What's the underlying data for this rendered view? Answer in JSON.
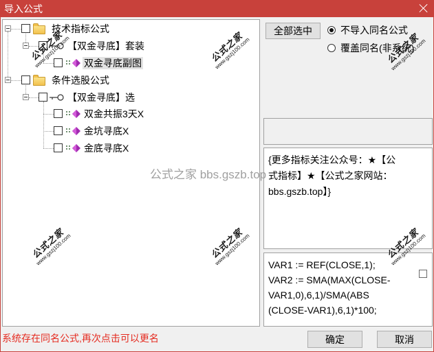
{
  "window": {
    "title": "导入公式"
  },
  "tree": [
    {
      "label": "技术指标公式",
      "icon": "folder-icon",
      "expanded": true,
      "checked": false,
      "children": [
        {
          "label": "【双金寻底】套装",
          "icon": "key-icon",
          "expanded": true,
          "checked": false,
          "children": [
            {
              "label": "双金寻底副图",
              "icon": "diamond-icon",
              "checked": false,
              "selected": true
            }
          ]
        }
      ]
    },
    {
      "label": "条件选股公式",
      "icon": "folder-icon",
      "expanded": true,
      "checked": false,
      "children": [
        {
          "label": "【双金寻底】选",
          "icon": "key-icon",
          "expanded": true,
          "checked": false,
          "children": [
            {
              "label": "双金共振3天X",
              "icon": "diamond-icon",
              "checked": false,
              "selected": false
            },
            {
              "label": "金坑寻底X",
              "icon": "diamond-icon",
              "checked": false,
              "selected": false
            },
            {
              "label": "金底寻底X",
              "icon": "diamond-icon",
              "checked": false,
              "selected": false
            }
          ]
        }
      ]
    }
  ],
  "toolbar": {
    "select_all_label": "全部选中"
  },
  "import_options": [
    {
      "label": "不导入同名公式",
      "checked": true
    },
    {
      "label": "覆盖同名(非系统)",
      "checked": false
    }
  ],
  "description": {
    "lines": [
      "{更多指标关注公众号：★【公",
      "式指标】★【公式之家网站：",
      "bbs.gszb.top】}"
    ]
  },
  "formula": {
    "lines": [
      "VAR1 := REF(CLOSE,1);",
      "VAR2 := SMA(MAX(CLOSE-",
      "VAR1,0),6,1)/SMA(ABS",
      "(CLOSE-VAR1),6,1)*100;"
    ],
    "checkbox_checked": false
  },
  "status_message": "系统存在同名公式,再次点击可以更名",
  "buttons": {
    "ok_label": "确定",
    "cancel_label": "取消"
  },
  "watermarks": {
    "brand": "公式之家",
    "site": "www.gszj100.com",
    "overlay": "公式之家 bbs.gszb.top"
  },
  "colors": {
    "titlebar": "#c8413b",
    "status_text": "#e52b20",
    "diamond": "#a02ab0",
    "folder": "#f2c14e"
  }
}
